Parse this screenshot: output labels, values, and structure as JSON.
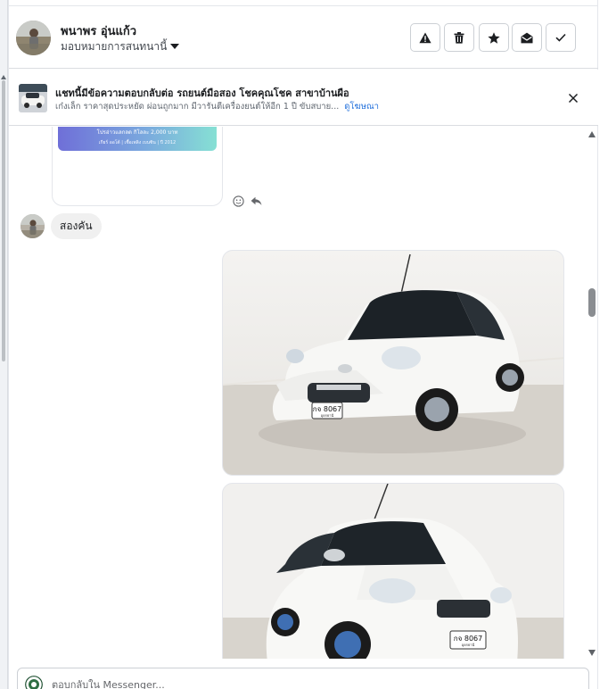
{
  "conversation": {
    "user_name": "พนาพร อุ่นแก้ว",
    "assign_label": "มอบหมายการสนทนานี้"
  },
  "header_actions": [
    {
      "name": "spam-button",
      "icon": "warning-icon"
    },
    {
      "name": "delete-button",
      "icon": "trash-icon"
    },
    {
      "name": "star-button",
      "icon": "star-icon"
    },
    {
      "name": "mark-unread-button",
      "icon": "envelope-open-icon"
    },
    {
      "name": "mark-done-button",
      "icon": "check-icon"
    }
  ],
  "ad_context": {
    "title": "แชทนี้มีข้อความตอบกลับต่อ รถยนต์มือสอง โชคคุณโชค สาขาบ้านผือ",
    "description": "เก๋งเล็ก ราคาสุดประหยัด ผ่อนถูกมาก มีวารันตีเครื่องยนต์ให้อีก 1 ปี ขับสบาย...",
    "link_label": "ดูโฆษณา"
  },
  "messages": {
    "card_price_line": "โปรอ่าวแลกลด  กิโลละ 2,000 บาท",
    "card_meta_line": "เกียร์ ออโต้  |  เชื้อเพลิง เบนซิน  |  ปี 2012",
    "customer_text": "สองคัน"
  },
  "car_plate": {
    "line1": "กจ 8067",
    "line2": "อุดรธานี"
  },
  "composer": {
    "placeholder": "ตอบกลับใน Messenger..."
  },
  "colors": {
    "link": "#216fdb",
    "border": "#ccd0d5",
    "bubble": "#f0f0f0"
  }
}
